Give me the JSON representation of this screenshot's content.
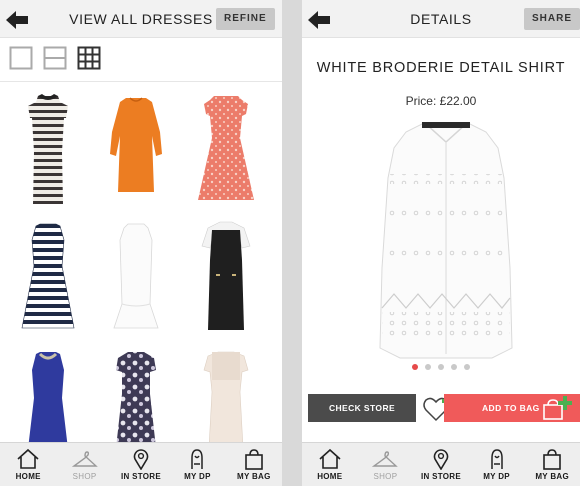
{
  "list_screen": {
    "title": "VIEW ALL DRESSES",
    "refine_label": "REFINE",
    "view_toggles": [
      "single-view-icon",
      "list-view-icon",
      "grid-view-icon"
    ],
    "products": [
      {
        "name": "striped-bodycon-dress",
        "colors": [
          "#efece6",
          "#3a3535"
        ]
      },
      {
        "name": "orange-shift-dress",
        "colors": [
          "#ec7d22",
          "#d96b15"
        ]
      },
      {
        "name": "coral-print-skater-dress",
        "colors": [
          "#ec7c6a",
          "#f4b9ab"
        ]
      },
      {
        "name": "navy-stripe-skater-dress",
        "colors": [
          "#ffffff",
          "#1f2a45"
        ]
      },
      {
        "name": "white-peplum-hem-dress",
        "colors": [
          "#fbfbfb",
          "#e2e2e2"
        ]
      },
      {
        "name": "black-pinafore-dress",
        "colors": [
          "#1f1f1f",
          "#f3f3f3"
        ]
      },
      {
        "name": "cobalt-embellished-dress",
        "colors": [
          "#2f3a9e",
          "#c9c2a8"
        ]
      },
      {
        "name": "floral-print-dress",
        "colors": [
          "#3e3a55",
          "#e8e6ee"
        ]
      },
      {
        "name": "cream-lace-dress",
        "colors": [
          "#f1e6dc",
          "#e2d2c4"
        ]
      }
    ]
  },
  "detail_screen": {
    "title": "DETAILS",
    "share_label": "SHARE",
    "product_title": "WHITE BRODERIE DETAIL SHIRT",
    "price": "Price: £22.00",
    "image_count": 5,
    "active_image": 0,
    "check_store_label": "CHECK STORE",
    "add_to_bag_label": "ADD TO BAG"
  },
  "tabs": [
    {
      "label": "HOME",
      "icon": "home-icon",
      "active": true
    },
    {
      "label": "SHOP",
      "icon": "hanger-icon",
      "active": false
    },
    {
      "label": "IN STORE",
      "icon": "location-pin-icon",
      "active": true
    },
    {
      "label": "MY DP",
      "icon": "my-dp-icon",
      "active": true
    },
    {
      "label": "MY BAG",
      "icon": "shopping-bag-icon",
      "active": true
    }
  ],
  "colors": {
    "accent_red": "#f05a5a",
    "add_green": "#4caf50",
    "dark_button": "#4b4b4b",
    "topbar_bg": "#f2f2f2"
  }
}
